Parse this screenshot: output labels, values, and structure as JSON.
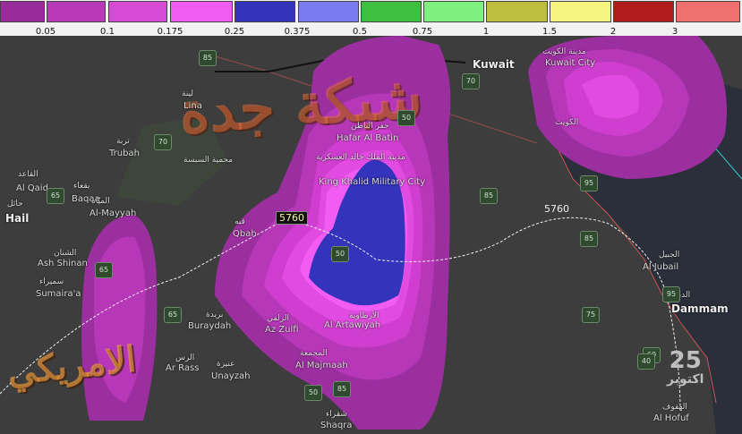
{
  "legend": {
    "swatches": [
      {
        "color": "#9a2b9a"
      },
      {
        "color": "#b93ab9"
      },
      {
        "color": "#d64bd6"
      },
      {
        "color": "#f05cf0"
      },
      {
        "color": "#3333bb"
      },
      {
        "color": "#7b7bf0"
      },
      {
        "color": "#3fbf3f"
      },
      {
        "color": "#7fef7f"
      },
      {
        "color": "#bfbf3f"
      },
      {
        "color": "#f5f57f"
      },
      {
        "color": "#b01c1c"
      },
      {
        "color": "#f07070"
      }
    ],
    "ticks": [
      "0.05",
      "0.1",
      "0.175",
      "0.25",
      "0.375",
      "0.5",
      "0.75",
      "1",
      "1.5",
      "2",
      "3"
    ]
  },
  "precip_colors": {
    "outer": "#9c2fa0",
    "ring2": "#b637b8",
    "ring3": "#cf3ecf",
    "ring4": "#e24be2",
    "ring5": "#f25cf2",
    "core": "#3333bb"
  },
  "contours": {
    "label_left": "5760",
    "label_right": "5760"
  },
  "places": [
    {
      "name": "Kuwait"
    },
    {
      "name": "مدينة الكويت"
    },
    {
      "name": "Kuwait City"
    },
    {
      "name": "الكويت"
    },
    {
      "name": "Hafar Al Batin"
    },
    {
      "name": "حفر الباطن"
    },
    {
      "name": "مدينة الملك خالد العسكرية"
    },
    {
      "name": "King Khalid Military City"
    },
    {
      "name": "Al Qaid"
    },
    {
      "name": "القاعد"
    },
    {
      "name": "Baqaa"
    },
    {
      "name": "بقعاء"
    },
    {
      "name": "Hail"
    },
    {
      "name": "حائل"
    },
    {
      "name": "Al-Mayyah"
    },
    {
      "name": "الميّاه"
    },
    {
      "name": "Trubah"
    },
    {
      "name": "تربة"
    },
    {
      "name": "محمية السبسة"
    },
    {
      "name": "Qbah"
    },
    {
      "name": "قبه"
    },
    {
      "name": "Ash Shinan"
    },
    {
      "name": "الشنان"
    },
    {
      "name": "Sumaira'a"
    },
    {
      "name": "سميراء"
    },
    {
      "name": "Buraydah"
    },
    {
      "name": "بريدة"
    },
    {
      "name": "Ar Rass"
    },
    {
      "name": "الرس"
    },
    {
      "name": "Unayzah"
    },
    {
      "name": "عنيزة"
    },
    {
      "name": "Az Zulfi"
    },
    {
      "name": "الزلفي"
    },
    {
      "name": "Al Artawiyah"
    },
    {
      "name": "الأرطاوية"
    },
    {
      "name": "Al Majmaah"
    },
    {
      "name": "المجمعة"
    },
    {
      "name": "Shaqra"
    },
    {
      "name": "شقراء"
    },
    {
      "name": "Al Jubail"
    },
    {
      "name": "الجبيل"
    },
    {
      "name": "Dammam"
    },
    {
      "name": "الدمام"
    },
    {
      "name": "Al Hofuf"
    },
    {
      "name": "الهفوف"
    },
    {
      "name": "Lina"
    },
    {
      "name": "لينة"
    }
  ],
  "roads": [
    "85",
    "70",
    "50",
    "70",
    "65",
    "65",
    "65",
    "50",
    "85",
    "85",
    "95",
    "85",
    "75",
    "95",
    "50",
    "60",
    "40"
  ],
  "watermarks": {
    "top": "شبكة جدة",
    "bottom": "الامريكي"
  },
  "date": {
    "day": "25",
    "month": "اكتوبر"
  }
}
